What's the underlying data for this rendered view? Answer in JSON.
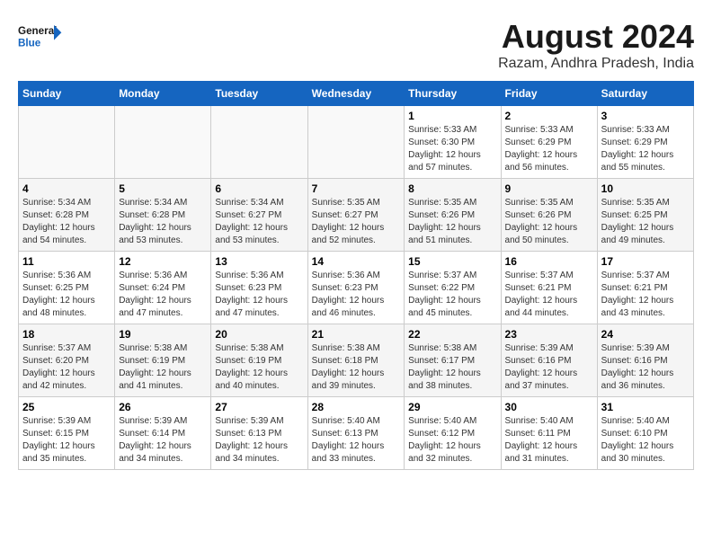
{
  "header": {
    "logo_general": "General",
    "logo_blue": "Blue",
    "month_year": "August 2024",
    "location": "Razam, Andhra Pradesh, India"
  },
  "weekdays": [
    "Sunday",
    "Monday",
    "Tuesday",
    "Wednesday",
    "Thursday",
    "Friday",
    "Saturday"
  ],
  "weeks": [
    [
      {
        "day": "",
        "sunrise": "",
        "sunset": "",
        "daylight": ""
      },
      {
        "day": "",
        "sunrise": "",
        "sunset": "",
        "daylight": ""
      },
      {
        "day": "",
        "sunrise": "",
        "sunset": "",
        "daylight": ""
      },
      {
        "day": "",
        "sunrise": "",
        "sunset": "",
        "daylight": ""
      },
      {
        "day": "1",
        "sunrise": "5:33 AM",
        "sunset": "6:30 PM",
        "daylight": "12 hours and 57 minutes."
      },
      {
        "day": "2",
        "sunrise": "5:33 AM",
        "sunset": "6:29 PM",
        "daylight": "12 hours and 56 minutes."
      },
      {
        "day": "3",
        "sunrise": "5:33 AM",
        "sunset": "6:29 PM",
        "daylight": "12 hours and 55 minutes."
      }
    ],
    [
      {
        "day": "4",
        "sunrise": "5:34 AM",
        "sunset": "6:28 PM",
        "daylight": "12 hours and 54 minutes."
      },
      {
        "day": "5",
        "sunrise": "5:34 AM",
        "sunset": "6:28 PM",
        "daylight": "12 hours and 53 minutes."
      },
      {
        "day": "6",
        "sunrise": "5:34 AM",
        "sunset": "6:27 PM",
        "daylight": "12 hours and 53 minutes."
      },
      {
        "day": "7",
        "sunrise": "5:35 AM",
        "sunset": "6:27 PM",
        "daylight": "12 hours and 52 minutes."
      },
      {
        "day": "8",
        "sunrise": "5:35 AM",
        "sunset": "6:26 PM",
        "daylight": "12 hours and 51 minutes."
      },
      {
        "day": "9",
        "sunrise": "5:35 AM",
        "sunset": "6:26 PM",
        "daylight": "12 hours and 50 minutes."
      },
      {
        "day": "10",
        "sunrise": "5:35 AM",
        "sunset": "6:25 PM",
        "daylight": "12 hours and 49 minutes."
      }
    ],
    [
      {
        "day": "11",
        "sunrise": "5:36 AM",
        "sunset": "6:25 PM",
        "daylight": "12 hours and 48 minutes."
      },
      {
        "day": "12",
        "sunrise": "5:36 AM",
        "sunset": "6:24 PM",
        "daylight": "12 hours and 47 minutes."
      },
      {
        "day": "13",
        "sunrise": "5:36 AM",
        "sunset": "6:23 PM",
        "daylight": "12 hours and 47 minutes."
      },
      {
        "day": "14",
        "sunrise": "5:36 AM",
        "sunset": "6:23 PM",
        "daylight": "12 hours and 46 minutes."
      },
      {
        "day": "15",
        "sunrise": "5:37 AM",
        "sunset": "6:22 PM",
        "daylight": "12 hours and 45 minutes."
      },
      {
        "day": "16",
        "sunrise": "5:37 AM",
        "sunset": "6:21 PM",
        "daylight": "12 hours and 44 minutes."
      },
      {
        "day": "17",
        "sunrise": "5:37 AM",
        "sunset": "6:21 PM",
        "daylight": "12 hours and 43 minutes."
      }
    ],
    [
      {
        "day": "18",
        "sunrise": "5:37 AM",
        "sunset": "6:20 PM",
        "daylight": "12 hours and 42 minutes."
      },
      {
        "day": "19",
        "sunrise": "5:38 AM",
        "sunset": "6:19 PM",
        "daylight": "12 hours and 41 minutes."
      },
      {
        "day": "20",
        "sunrise": "5:38 AM",
        "sunset": "6:19 PM",
        "daylight": "12 hours and 40 minutes."
      },
      {
        "day": "21",
        "sunrise": "5:38 AM",
        "sunset": "6:18 PM",
        "daylight": "12 hours and 39 minutes."
      },
      {
        "day": "22",
        "sunrise": "5:38 AM",
        "sunset": "6:17 PM",
        "daylight": "12 hours and 38 minutes."
      },
      {
        "day": "23",
        "sunrise": "5:39 AM",
        "sunset": "6:16 PM",
        "daylight": "12 hours and 37 minutes."
      },
      {
        "day": "24",
        "sunrise": "5:39 AM",
        "sunset": "6:16 PM",
        "daylight": "12 hours and 36 minutes."
      }
    ],
    [
      {
        "day": "25",
        "sunrise": "5:39 AM",
        "sunset": "6:15 PM",
        "daylight": "12 hours and 35 minutes."
      },
      {
        "day": "26",
        "sunrise": "5:39 AM",
        "sunset": "6:14 PM",
        "daylight": "12 hours and 34 minutes."
      },
      {
        "day": "27",
        "sunrise": "5:39 AM",
        "sunset": "6:13 PM",
        "daylight": "12 hours and 34 minutes."
      },
      {
        "day": "28",
        "sunrise": "5:40 AM",
        "sunset": "6:13 PM",
        "daylight": "12 hours and 33 minutes."
      },
      {
        "day": "29",
        "sunrise": "5:40 AM",
        "sunset": "6:12 PM",
        "daylight": "12 hours and 32 minutes."
      },
      {
        "day": "30",
        "sunrise": "5:40 AM",
        "sunset": "6:11 PM",
        "daylight": "12 hours and 31 minutes."
      },
      {
        "day": "31",
        "sunrise": "5:40 AM",
        "sunset": "6:10 PM",
        "daylight": "12 hours and 30 minutes."
      }
    ]
  ]
}
